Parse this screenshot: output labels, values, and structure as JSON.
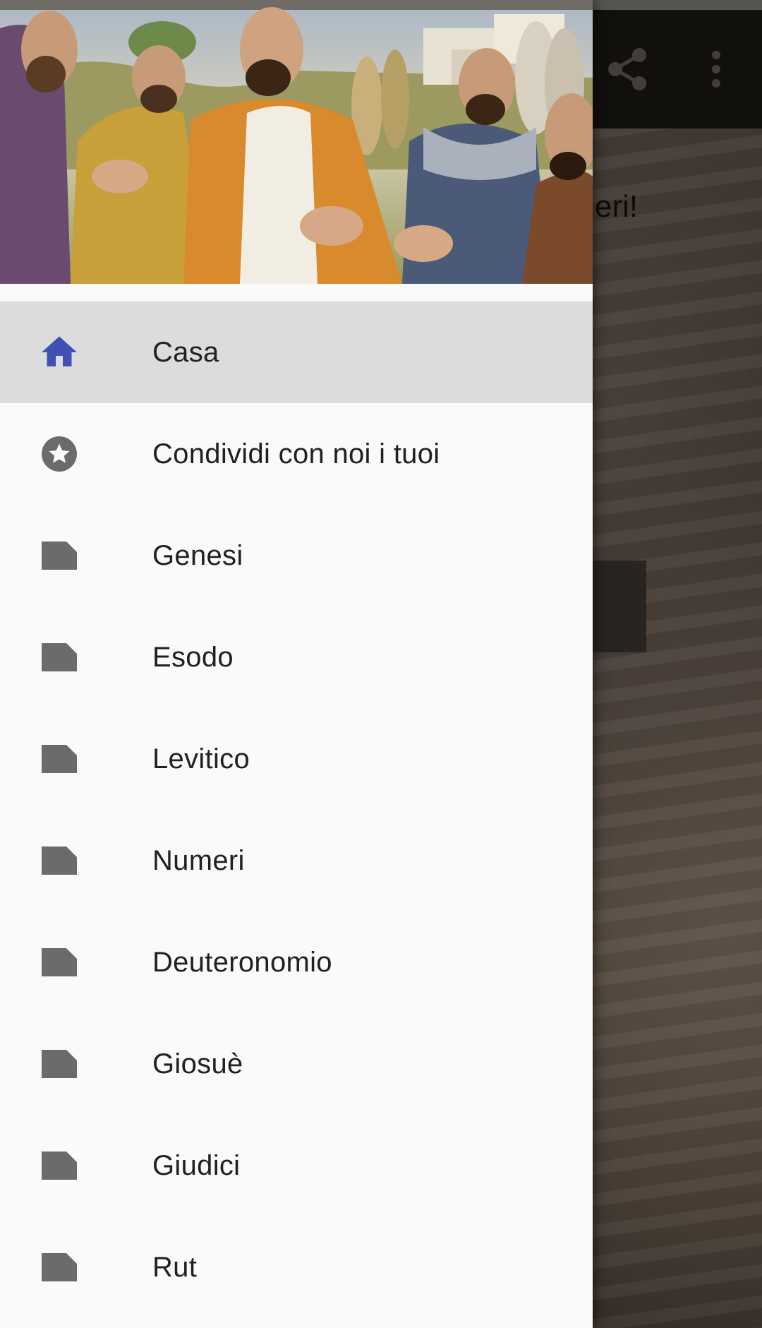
{
  "background_app": {
    "visible_text_fragment": "eri!",
    "share_icon": "share-icon",
    "more_icon": "more-vert-icon"
  },
  "drawer": {
    "header_image": "apostles-illustration",
    "items": [
      {
        "label": "Casa",
        "icon": "home-icon",
        "selected": true
      },
      {
        "label": "Condividi con noi i tuoi",
        "icon": "star-circle-icon",
        "selected": false
      },
      {
        "label": "Genesi",
        "icon": "note-icon",
        "selected": false
      },
      {
        "label": "Esodo",
        "icon": "note-icon",
        "selected": false
      },
      {
        "label": "Levitico",
        "icon": "note-icon",
        "selected": false
      },
      {
        "label": "Numeri",
        "icon": "note-icon",
        "selected": false
      },
      {
        "label": "Deuteronomio",
        "icon": "note-icon",
        "selected": false
      },
      {
        "label": "Giosuè",
        "icon": "note-icon",
        "selected": false
      },
      {
        "label": "Giudici",
        "icon": "note-icon",
        "selected": false
      },
      {
        "label": "Rut",
        "icon": "note-icon",
        "selected": false
      }
    ]
  },
  "colors": {
    "selected_bg": "#dcdcdc",
    "home_icon": "#3f51b5",
    "grey_icon": "#6b6b6b",
    "drawer_bg": "#fafafa",
    "label_text": "#212121"
  }
}
